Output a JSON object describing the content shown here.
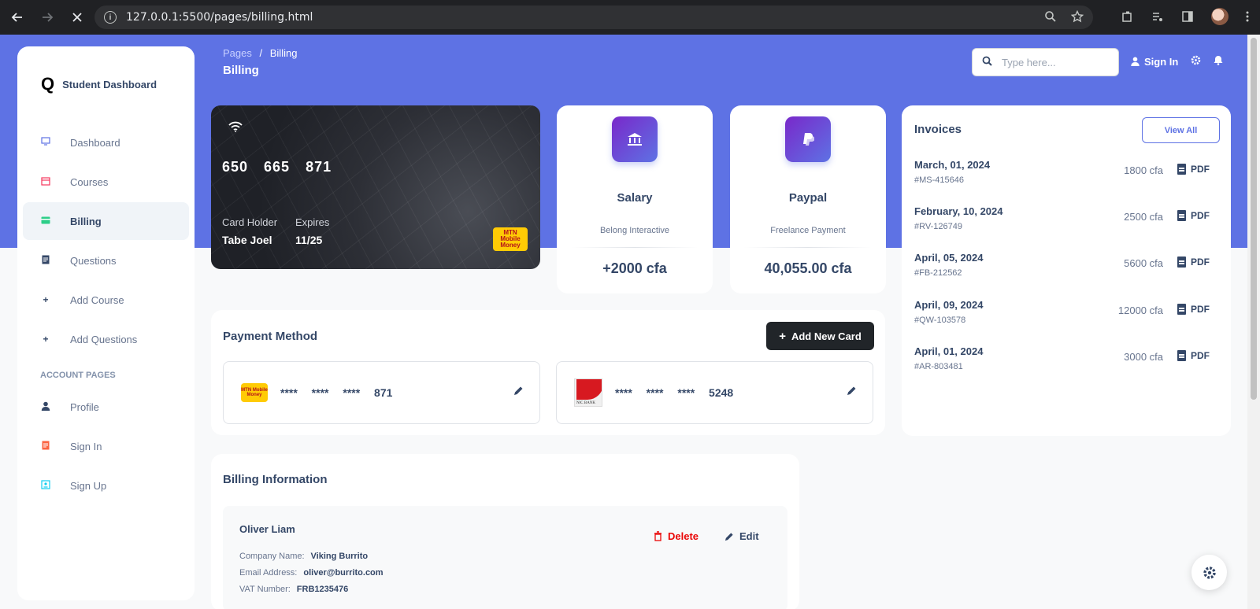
{
  "browser": {
    "url": "127.0.0.1:5500/pages/billing.html"
  },
  "sidebar": {
    "brand": "Student Dashboard",
    "items": [
      {
        "label": "Dashboard",
        "icon": "monitor-icon"
      },
      {
        "label": "Courses",
        "icon": "calendar-icon"
      },
      {
        "label": "Billing",
        "icon": "credit-card-icon"
      },
      {
        "label": "Questions",
        "icon": "document-icon"
      },
      {
        "label": "Add Course",
        "icon": "plus-icon"
      },
      {
        "label": "Add Questions",
        "icon": "plus-icon"
      }
    ],
    "section_title": "ACCOUNT PAGES",
    "account_items": [
      {
        "label": "Profile",
        "icon": "user-icon"
      },
      {
        "label": "Sign In",
        "icon": "document-icon"
      },
      {
        "label": "Sign Up",
        "icon": "id-card-icon"
      }
    ]
  },
  "header": {
    "breadcrumb_parent": "Pages",
    "breadcrumb_sep": "/",
    "breadcrumb_current": "Billing",
    "title": "Billing",
    "search_placeholder": "Type here...",
    "signin_label": "Sign In"
  },
  "card": {
    "number": "650 665 871",
    "holder_label": "Card Holder",
    "holder": "Tabe Joel",
    "expires_label": "Expires",
    "expires": "11/25",
    "logo_text": "MTN Mobile Money"
  },
  "stats": [
    {
      "title": "Salary",
      "sub": "Belong Interactive",
      "amount": "+2000 cfa",
      "icon": "bank-icon"
    },
    {
      "title": "Paypal",
      "sub": "Freelance Payment",
      "amount": "40,055.00 cfa",
      "icon": "paypal-icon"
    }
  ],
  "invoices": {
    "title": "Invoices",
    "view_all": "View All",
    "pdf_label": "PDF",
    "rows": [
      {
        "date": "March, 01, 2024",
        "code": "#MS-415646",
        "amount": "1800 cfa"
      },
      {
        "date": "February, 10, 2024",
        "code": "#RV-126749",
        "amount": "2500 cfa"
      },
      {
        "date": "April, 05, 2024",
        "code": "#FB-212562",
        "amount": "5600 cfa"
      },
      {
        "date": "April, 09, 2024",
        "code": "#QW-103578",
        "amount": "12000 cfa"
      },
      {
        "date": "April, 01, 2024",
        "code": "#AR-803481",
        "amount": "3000 cfa"
      }
    ]
  },
  "payment": {
    "title": "Payment Method",
    "add_label": "Add New Card",
    "cards": [
      {
        "number": "**** **** **** 871",
        "logo": "MTN Mobile Money"
      },
      {
        "number": "**** **** **** 5248",
        "logo": "NIC BANK"
      }
    ]
  },
  "billing": {
    "title": "Billing Information",
    "name": "Oliver Liam",
    "company_label": "Company Name:",
    "company": "Viking Burrito",
    "email_label": "Email Address:",
    "email": "oliver@burrito.com",
    "vat_label": "VAT Number:",
    "vat": "FRB1235476",
    "delete_label": "Delete",
    "edit_label": "Edit"
  },
  "colors": {
    "primary": "#5e72e4",
    "dark": "#344767",
    "danger": "#ea0606"
  }
}
